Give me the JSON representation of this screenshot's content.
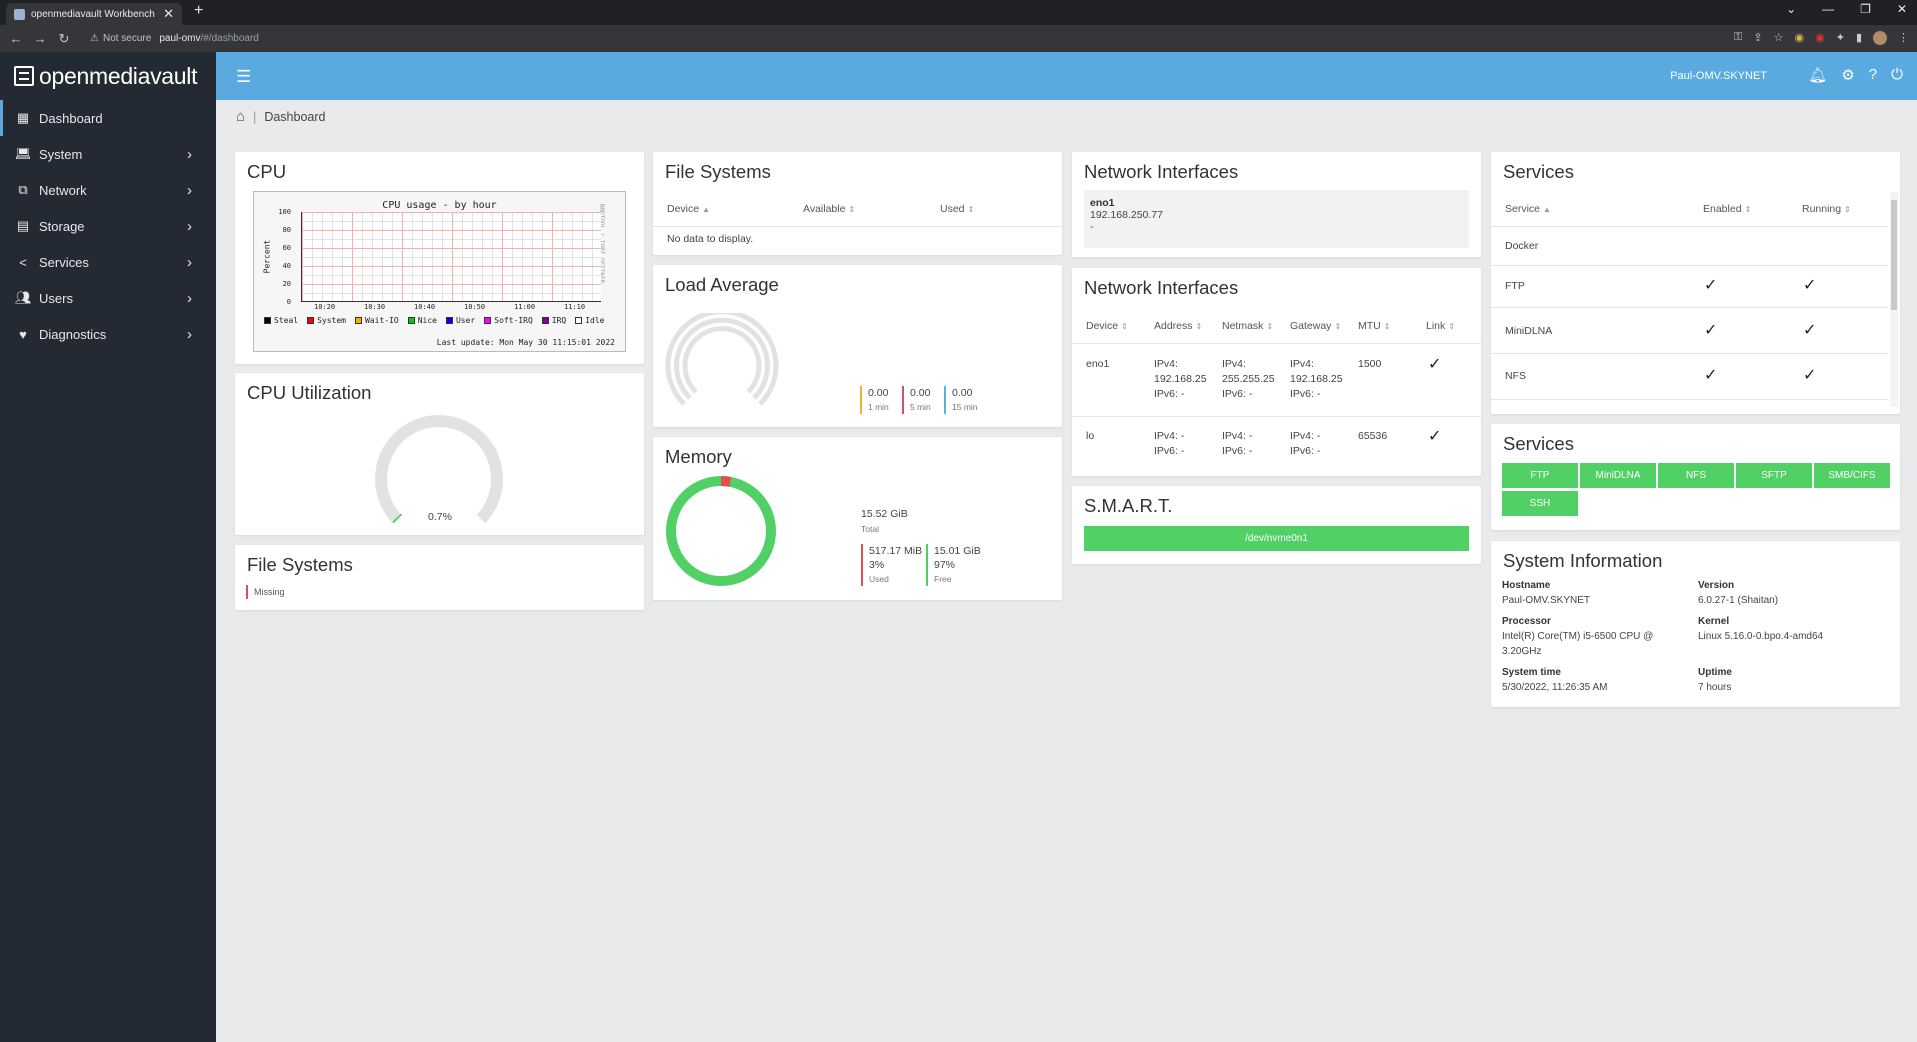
{
  "browser": {
    "tab_title": "openmediavault Workbench",
    "not_secure": "Not secure",
    "url_host": "paul-omv",
    "url_path": "/#/dashboard"
  },
  "app": {
    "brand": "openmediavault",
    "user": "Paul-OMV.SKYNET"
  },
  "sidebar": {
    "items": [
      {
        "label": "Dashboard",
        "icon": "grid-icon"
      },
      {
        "label": "System",
        "icon": "laptop-icon"
      },
      {
        "label": "Network",
        "icon": "network-icon"
      },
      {
        "label": "Storage",
        "icon": "storage-icon"
      },
      {
        "label": "Services",
        "icon": "share-icon"
      },
      {
        "label": "Users",
        "icon": "users-icon"
      },
      {
        "label": "Diagnostics",
        "icon": "heartbeat-icon"
      }
    ]
  },
  "breadcrumb": {
    "current": "Dashboard"
  },
  "cpu": {
    "title": "CPU",
    "chart_data": {
      "type": "area",
      "title": "CPU usage - by hour",
      "ylabel": "Percent",
      "yticks": [
        "100",
        "80",
        "60",
        "40",
        "20",
        "0"
      ],
      "xticks": [
        "10:20",
        "10:30",
        "10:40",
        "10:50",
        "11:00",
        "11:10"
      ],
      "legend": [
        {
          "name": "Steal",
          "color": "#000000"
        },
        {
          "name": "System",
          "color": "#ff0000"
        },
        {
          "name": "Wait-IO",
          "color": "#ffb000"
        },
        {
          "name": "Nice",
          "color": "#00cc00"
        },
        {
          "name": "User",
          "color": "#0000ff"
        },
        {
          "name": "Soft-IRQ",
          "color": "#ff00ff"
        },
        {
          "name": "IRQ",
          "color": "#8000a0"
        },
        {
          "name": "Idle",
          "color": "#ffffff"
        }
      ],
      "last_update": "Last update: Mon May 30 11:15:01 2022",
      "side_text": "RRDTOOL / TOBI OETIKER"
    }
  },
  "cpu_util": {
    "title": "CPU Utilization",
    "value": "0.7%",
    "level": 0.007
  },
  "fs_missing": {
    "title": "File Systems",
    "status": "Missing"
  },
  "filesystems": {
    "title": "File Systems",
    "headers": [
      "Device",
      "Available",
      "Used"
    ],
    "empty": "No data to display."
  },
  "load": {
    "title": "Load Average",
    "values": [
      {
        "value": "0.00",
        "label": "1 min",
        "color": "#f0b030"
      },
      {
        "value": "0.00",
        "label": "5 min",
        "color": "#d05070"
      },
      {
        "value": "0.00",
        "label": "15 min",
        "color": "#5ab0e0"
      }
    ]
  },
  "memory": {
    "title": "Memory",
    "total": "15.52 GiB",
    "total_label": "Total",
    "used": "517.17 MiB",
    "used_pct": "3%",
    "used_label": "Used",
    "free": "15.01 GiB",
    "free_pct": "97%",
    "free_label": "Free",
    "used_fraction": 0.03
  },
  "net_summary": {
    "title": "Network Interfaces",
    "name": "eno1",
    "address": "192.168.250.77",
    "extra": "-"
  },
  "net_table": {
    "title": "Network Interfaces",
    "headers": [
      "Device",
      "Address",
      "Netmask",
      "Gateway",
      "MTU",
      "Link"
    ],
    "rows": [
      {
        "device": "eno1",
        "addr1": "IPv4:",
        "addr2": "192.168.25",
        "addr3": "IPv6: -",
        "mask1": "IPv4:",
        "mask2": "255.255.25",
        "mask3": "IPv6: -",
        "gw1": "IPv4:",
        "gw2": "192.168.25",
        "gw3": "IPv6: -",
        "mtu": "1500"
      },
      {
        "device": "lo",
        "addr1": "IPv4: -",
        "addr2": "IPv6: -",
        "mask1": "IPv4: -",
        "mask2": "IPv6: -",
        "gw1": "IPv4: -",
        "gw2": "IPv6: -",
        "mtu": "65536"
      }
    ]
  },
  "smart": {
    "title": "S.M.A.R.T.",
    "device": "/dev/nvme0n1"
  },
  "services_table": {
    "title": "Services",
    "headers": [
      "Service",
      "Enabled",
      "Running"
    ],
    "rows": [
      "Docker",
      "FTP",
      "MiniDLNA",
      "NFS"
    ]
  },
  "services_buttons": {
    "title": "Services",
    "items": [
      "FTP",
      "MiniDLNA",
      "NFS",
      "SFTP",
      "SMB/CIFS",
      "SSH"
    ]
  },
  "sysinfo": {
    "title": "System Information",
    "hostname_label": "Hostname",
    "hostname": "Paul-OMV.SKYNET",
    "version_label": "Version",
    "version": "6.0.27-1 (Shaitan)",
    "processor_label": "Processor",
    "processor": "Intel(R) Core(TM) i5-6500 CPU @ 3.20GHz",
    "kernel_label": "Kernel",
    "kernel": "Linux 5.16.0-0.bpo.4-amd64",
    "time_label": "System time",
    "time": "5/30/2022, 11:26:35 AM",
    "uptime_label": "Uptime",
    "uptime": "7 hours"
  }
}
